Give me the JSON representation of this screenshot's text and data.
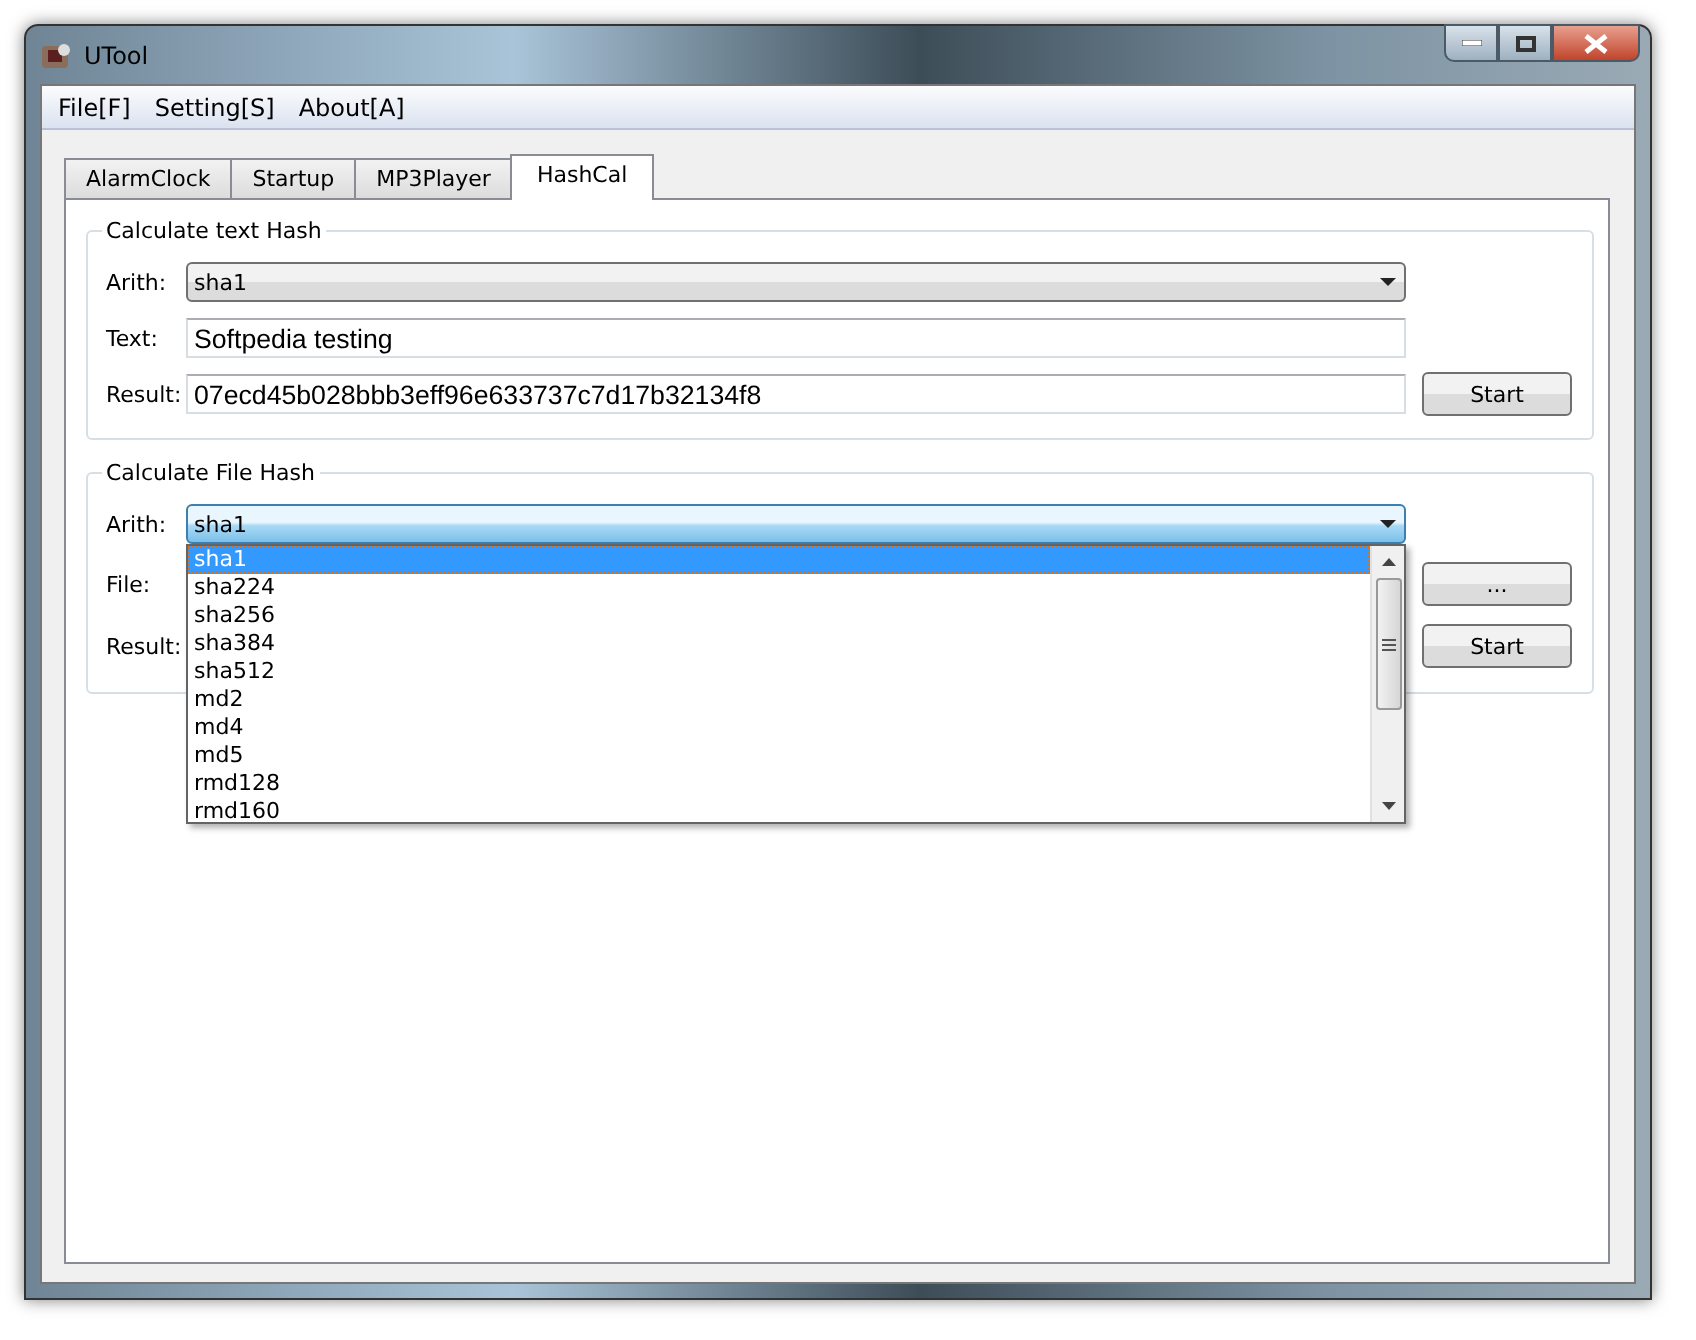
{
  "window": {
    "title": "UTool"
  },
  "menu": [
    "File[F]",
    "Setting[S]",
    "About[A]"
  ],
  "tabs": [
    {
      "label": "AlarmClock",
      "selected": false
    },
    {
      "label": "Startup",
      "selected": false
    },
    {
      "label": "MP3Player",
      "selected": false
    },
    {
      "label": "HashCal",
      "selected": true
    }
  ],
  "text_hash": {
    "title": "Calculate text Hash",
    "arith_label": "Arith:",
    "arith_value": "sha1",
    "text_label": "Text:",
    "text_value": "Softpedia testing",
    "result_label": "Result:",
    "result_value": "07ecd45b028bbb3eff96e633737c7d17b32134f8",
    "start": "Start"
  },
  "file_hash": {
    "title": "Calculate File Hash",
    "arith_label": "Arith:",
    "arith_value": "sha1",
    "expanded": true,
    "file_label": "File:",
    "browse": "...",
    "result_label": "Result:",
    "start": "Start",
    "options": [
      {
        "label": "sha1",
        "selected": true
      },
      {
        "label": "sha224",
        "selected": false
      },
      {
        "label": "sha256",
        "selected": false
      },
      {
        "label": "sha384",
        "selected": false
      },
      {
        "label": "sha512",
        "selected": false
      },
      {
        "label": "md2",
        "selected": false
      },
      {
        "label": "md4",
        "selected": false
      },
      {
        "label": "md5",
        "selected": false
      },
      {
        "label": "rmd128",
        "selected": false
      },
      {
        "label": "rmd160",
        "selected": false
      }
    ]
  }
}
